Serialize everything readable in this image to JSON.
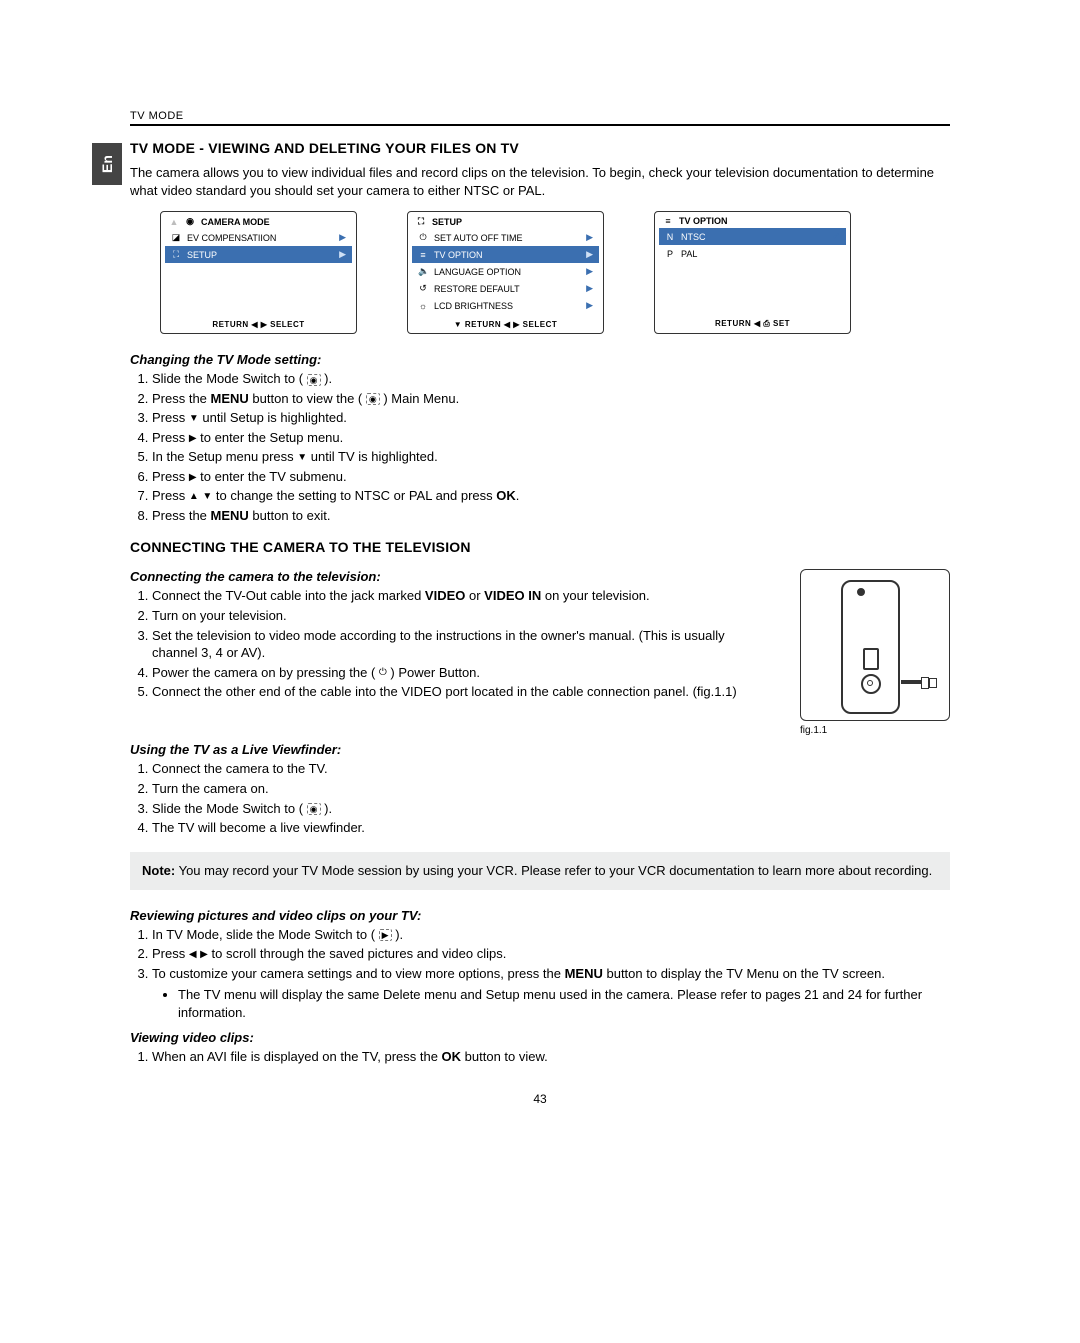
{
  "lang_tab": "En",
  "header_section": "TV MODE",
  "title1": "TV MODE - VIEWING AND DELETING YOUR FILES ON TV",
  "intro": "The camera allows you to view individual files and record clips on the television. To begin, check your television documentation to determine what video standard you should set your camera to either NTSC or PAL.",
  "screen1": {
    "title": "CAMERA MODE",
    "rows": [
      "EV COMPENSATIION",
      "SETUP"
    ],
    "footer": "RETURN  ◀  ▶  SELECT"
  },
  "screen2": {
    "title": "SETUP",
    "rows": [
      "SET AUTO OFF TIME",
      "TV OPTION",
      "LANGUAGE OPTION",
      "RESTORE DEFAULT",
      "LCD BRIGHTNESS"
    ],
    "footer": "▼  RETURN  ◀  ▶  SELECT"
  },
  "screen3": {
    "title": "TV OPTION",
    "rows": [
      "NTSC",
      "PAL"
    ],
    "footer": "RETURN  ◀   ⎙ SET"
  },
  "sub1": "Changing the TV Mode setting:",
  "steps1": {
    "s1a": "Slide the Mode Switch to ( ",
    "s1b": " ).",
    "s2a": "Press the ",
    "s2b": " button to view the ( ",
    "s2c": " ) Main Menu.",
    "menu": "MENU",
    "s3a": "Press  ",
    "s3b": "  until Setup is highlighted.",
    "s4a": "Press  ",
    "s4b": "  to enter the Setup menu.",
    "s5a": "In the Setup menu press  ",
    "s5b": "  until TV is highlighted.",
    "s6a": "Press  ",
    "s6b": "  to enter the TV submenu.",
    "s7a": "Press ",
    "s7b": " to change the setting to NTSC or PAL and press ",
    "ok": "OK",
    "s7c": ".",
    "s8a": "Press the ",
    "s8b": " button to exit."
  },
  "title2": "CONNECTING THE CAMERA TO THE TELEVISION",
  "sub2": "Connecting the camera to the television:",
  "steps2": {
    "s1a": "Connect the TV-Out cable into the jack marked ",
    "video": "VIDEO",
    "s1b": " or ",
    "videoin": "VIDEO IN",
    "s1c": " on your television.",
    "s2": "Turn on your television.",
    "s3": "Set the television to video mode according to the instructions in the owner's manual. (This is usually channel 3, 4 or AV).",
    "s4a": "Power the camera on by pressing the ( ",
    "s4b": " ) Power Button.",
    "s5": "Connect the other end of the cable into the VIDEO port located in the cable connection panel. (fig.1.1)"
  },
  "fig_caption": "fig.1.1",
  "sub3": "Using the TV as a Live Viewfinder:",
  "steps3": {
    "s1": "Connect the camera to the TV.",
    "s2": "Turn the camera on.",
    "s3a": "Slide the Mode Switch to ( ",
    "s3b": " ).",
    "s4": "The TV will become a live viewfinder."
  },
  "note": {
    "label": "Note:",
    "text": " You may record your TV Mode session by using your VCR.  Please refer to your VCR documentation to learn more about recording."
  },
  "sub4": "Reviewing pictures and video clips on your TV:",
  "steps4": {
    "s1a": "In TV Mode, slide the Mode Switch to ( ",
    "s1b": " ).",
    "s2a": "Press  ",
    "s2b": "   to scroll through the saved pictures and video clips.",
    "s3a": "To customize your camera settings and to view more options, press the ",
    "menu": "MENU",
    "s3b": " button to display the TV Menu on the TV screen.",
    "bul": "The TV menu will display the same Delete menu and Setup menu used in the camera.  Please refer to pages 21 and 24 for further information."
  },
  "sub5": "Viewing video clips:",
  "steps5": {
    "s1a": "When an AVI file is displayed on the TV, press the ",
    "ok": "OK",
    "s1b": " button to view."
  },
  "page_number": "43"
}
